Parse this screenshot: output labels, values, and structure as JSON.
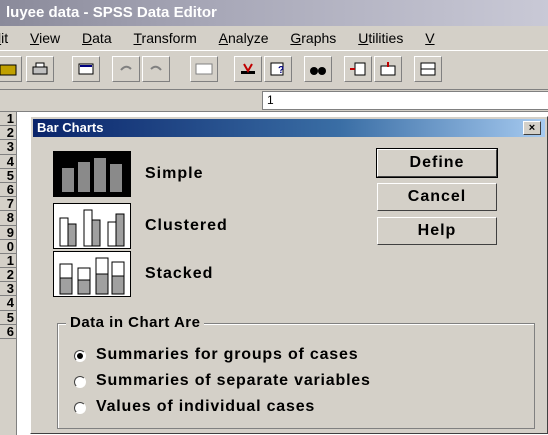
{
  "app": {
    "title": "luyee data - SPSS Data Editor",
    "menu": [
      "lit",
      "View",
      "Data",
      "Transform",
      "Analyze",
      "Graphs",
      "Utilities",
      "V"
    ]
  },
  "cell_editor": {
    "value": "1"
  },
  "row_numbers": [
    "1",
    "2",
    "3",
    "4",
    "5",
    "6",
    "7",
    "8",
    "9",
    "0",
    "1",
    "2",
    "3",
    "4",
    "5",
    "6"
  ],
  "dialog": {
    "title": "Bar Charts",
    "close_label": "×",
    "chart_types": [
      {
        "label": "Simple",
        "icon": "simple-bar-chart-icon",
        "selected": true
      },
      {
        "label": "Clustered",
        "icon": "clustered-bar-chart-icon",
        "selected": false
      },
      {
        "label": "Stacked",
        "icon": "stacked-bar-chart-icon",
        "selected": false
      }
    ],
    "buttons": {
      "define": "Define",
      "cancel": "Cancel",
      "help": "Help"
    },
    "group_title": "Data in Chart Are",
    "options": [
      {
        "label": "Summaries for groups of cases",
        "checked": true
      },
      {
        "label": "Summaries of separate variables",
        "checked": false
      },
      {
        "label": "Values of individual cases",
        "checked": false
      }
    ]
  },
  "colors": {
    "titlebar_active": "#0a246a",
    "face": "#d4d0c8"
  }
}
